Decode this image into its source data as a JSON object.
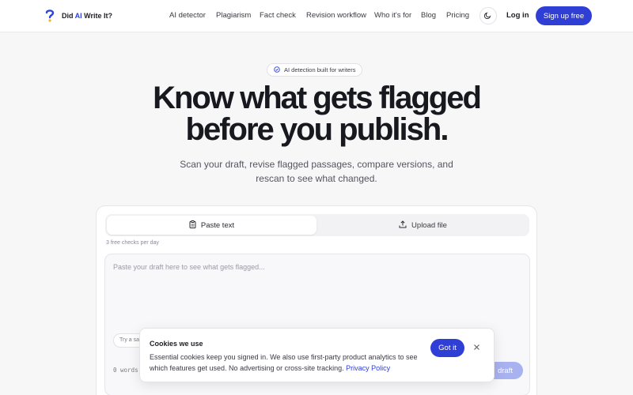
{
  "brand": {
    "prefix": "Did ",
    "accent": "AI",
    "suffix": " Write It?",
    "accent_color": "#2f43d9"
  },
  "nav": {
    "links": [
      "AI detector",
      "Plagiarism",
      "Fact check",
      "Revision workflow",
      "Who it's for",
      "Blog",
      "Pricing"
    ],
    "theme_icon": "moon-icon",
    "login": "Log in",
    "signup": "Sign up free"
  },
  "hero": {
    "badge": "AI detection built for writers",
    "title_line1": "Know what gets flagged",
    "title_line2": "before you publish.",
    "subtitle": "Scan your draft, revise flagged passages, compare versions, and rescan to see what changed."
  },
  "checker": {
    "tabs": [
      {
        "label": "Paste text",
        "icon": "clipboard-icon"
      },
      {
        "label": "Upload file",
        "icon": "upload-icon"
      }
    ],
    "quota": "3 free checks per day",
    "placeholder": "Paste your draft here to see what gets flagged...",
    "sample_chip": "Try a sam",
    "word_count": "0 words",
    "scan_button": "draft"
  },
  "cookie": {
    "title": "Cookies we use",
    "body": "Essential cookies keep you signed in. We also use first-party product analytics to see which features get used. No advertising or cross-site tracking.",
    "link": "Privacy Policy",
    "accept": "Got it"
  },
  "colors": {
    "primary": "#2f3fd6",
    "background": "#f7f7f8"
  }
}
